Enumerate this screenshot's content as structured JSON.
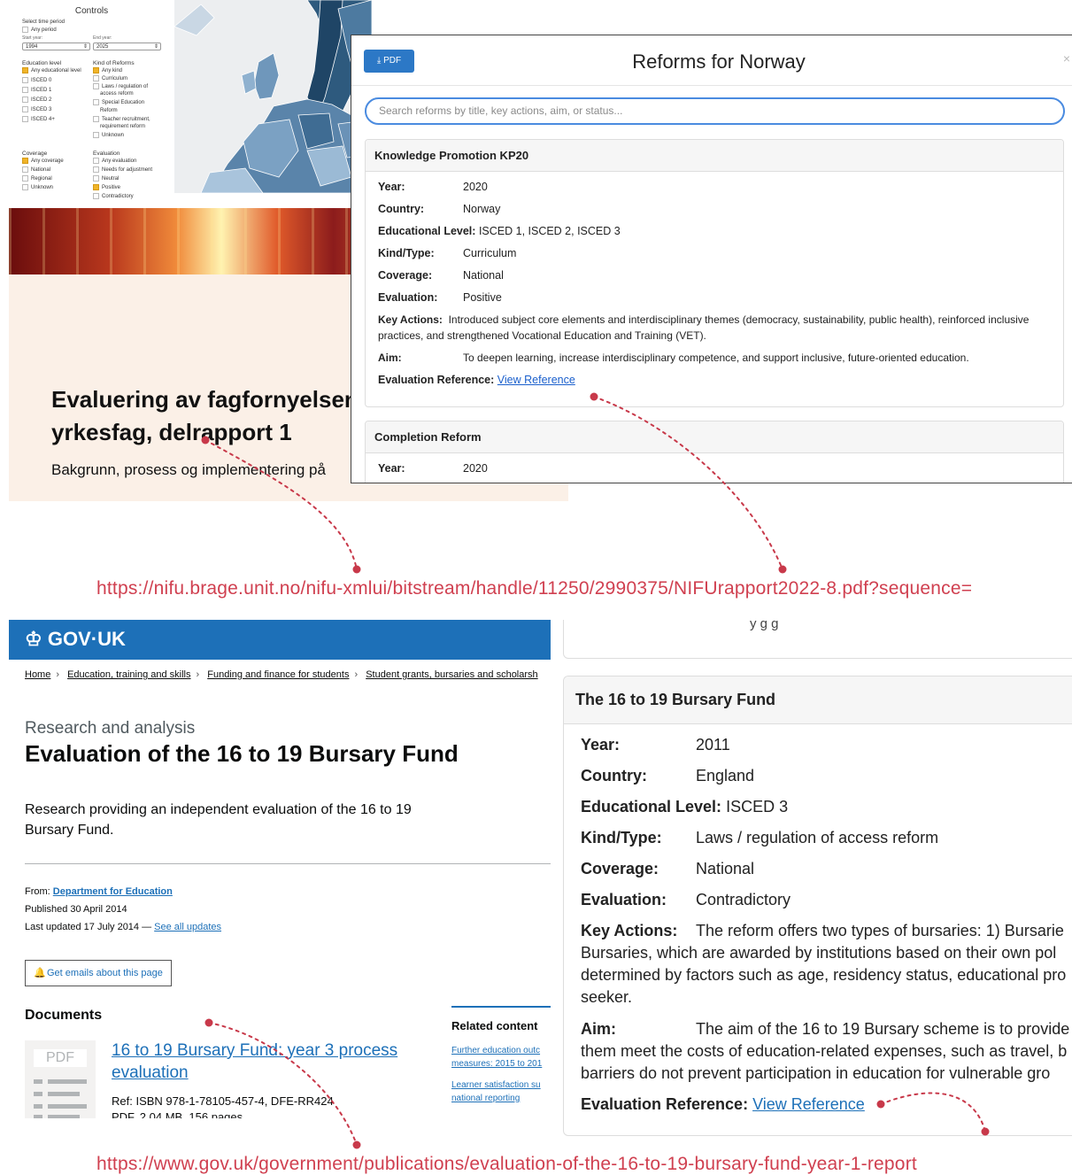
{
  "controls": {
    "title": "Controls",
    "time_label": "Select time period",
    "any_period": "Any period",
    "start_label": "Start year:",
    "end_label": "End year:",
    "start_value": "1994",
    "end_value": "2025",
    "edu_title": "Education level",
    "edu_items": [
      "Any educational level",
      "ISCED 0",
      "ISCED 1",
      "ISCED 2",
      "ISCED 3",
      "ISCED 4+"
    ],
    "kind_title": "Kind of Reforms",
    "kind_items": [
      "Any kind",
      "Curriculum",
      "Laws / regulation of",
      "access reform",
      "Special Education",
      "Reform",
      "Teacher recruitment,",
      "requirement reform",
      "Unknown"
    ],
    "coverage_title": "Coverage",
    "coverage_items": [
      "Any coverage",
      "National",
      "Regional",
      "Unknown"
    ],
    "evaluation_title": "Evaluation",
    "evaluation_items": [
      "Any evaluation",
      "Needs for adjustment",
      "Neutral",
      "Positive",
      "Contradictory"
    ]
  },
  "cover": {
    "title_line1": "Evaluering av fagfornyelsen",
    "title_line2": "yrkesfag, delrapport 1",
    "subtitle": "Bakgrunn, prosess og implementering på"
  },
  "modal": {
    "pdf_label": "PDF",
    "title": "Reforms for Norway",
    "close": "×",
    "search_placeholder": "Search reforms by title, key actions, aim, or status...",
    "card1": {
      "title": "Knowledge Promotion KP20",
      "year_label": "Year:",
      "year": "2020",
      "country_label": "Country:",
      "country": "Norway",
      "edu_label": "Educational Level:",
      "edu": "ISCED 1, ISCED 2, ISCED 3",
      "kind_label": "Kind/Type:",
      "kind": "Curriculum",
      "coverage_label": "Coverage:",
      "coverage": "National",
      "evaluation_label": "Evaluation:",
      "evaluation": "Positive",
      "key_label": "Key Actions:",
      "key": "Introduced subject core elements and interdisciplinary themes (democracy, sustainability, public health), reinforced inclusive practices, and strengthened Vocational Education and Training (VET).",
      "aim_label": "Aim:",
      "aim": "To deepen learning, increase interdisciplinary competence, and support inclusive, future-oriented education.",
      "ref_label": "Evaluation Reference:",
      "ref_link": "View Reference"
    },
    "card2": {
      "title": "Completion Reform",
      "year_label": "Year:",
      "year": "2020"
    }
  },
  "urls": {
    "norway": "https://nifu.brage.unit.no/nifu-xmlui/bitstream/handle/11250/2990375/NIFUrapport2022-8.pdf?sequence=",
    "england": "https://www.gov.uk/government/publications/evaluation-of-the-16-to-19-bursary-fund-year-1-report"
  },
  "gov": {
    "logo": "GOV·UK",
    "crumbs": [
      "Home",
      "Education, training and skills",
      "Funding and finance for students",
      "Student grants, bursaries and scholarsh"
    ],
    "caption": "Research and analysis",
    "title": "Evaluation of the 16 to 19 Bursary Fund",
    "description": "Research providing an independent evaluation of the 16 to 19 Bursary Fund.",
    "from_label": "From:",
    "from_link": "Department for Education",
    "published": "Published 30 April 2014",
    "updated": "Last updated 17 July 2014 —",
    "see_updates": "See all updates",
    "emails": "Get emails about this page",
    "documents": "Documents",
    "pdf_thumb": "PDF",
    "doc_link": "16 to 19 Bursary Fund: year 3 process evaluation",
    "doc_ref": "Ref: ISBN 978-1-78105-457-4, DFE-RR424",
    "doc_meta": "PDF, 2.04 MB, 156 pages",
    "related_title": "Related content",
    "related": [
      "Further education outc",
      "measures: 2015 to 201",
      "Learner satisfaction su",
      "national reporting"
    ]
  },
  "england": {
    "top_fragment": "y g          g",
    "title": "The 16 to 19 Bursary Fund",
    "year_label": "Year:",
    "year": "2011",
    "country_label": "Country:",
    "country": "England",
    "edu_label": "Educational Level:",
    "edu": "ISCED 3",
    "kind_label": "Kind/Type:",
    "kind": "Laws / regulation of access reform",
    "coverage_label": "Coverage:",
    "coverage": "National",
    "evaluation_label": "Evaluation:",
    "evaluation": "Contradictory",
    "key_label": "Key Actions:",
    "key_line1": "The reform offers two types of bursaries: 1) Bursarie",
    "key_line2": "Bursaries, which are awarded by institutions based on their own pol",
    "key_line3": "determined by factors such as age, residency status, educational pro",
    "key_line4": "seeker.",
    "aim_label": "Aim:",
    "aim_line1": "The aim of the 16 to 19 Bursary scheme is to provide",
    "aim_line2": "them meet the costs of education-related expenses, such as travel, b",
    "aim_line3": "barriers do not prevent participation in education for vulnerable gro",
    "ref_label": "Evaluation Reference:",
    "ref_link": "View Reference"
  },
  "colors": {
    "gov_blue": "#1d70b8",
    "url_red": "#d04050",
    "pdf_button": "#2c78c6",
    "checkbox_on": "#f0b429"
  }
}
